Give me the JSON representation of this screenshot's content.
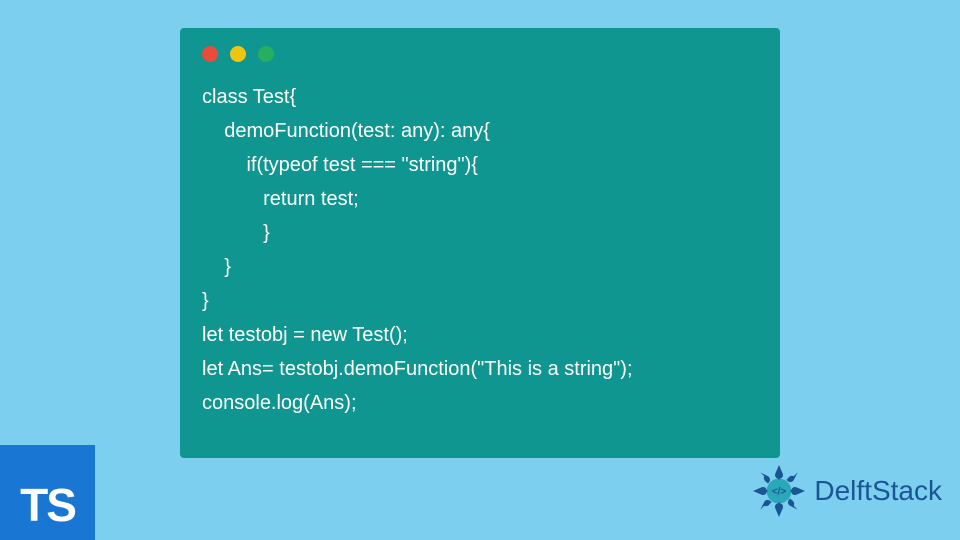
{
  "code": {
    "line1": "class Test{",
    "line2": "    demoFunction(test: any): any{",
    "line3": "        if(typeof test === \"string\"){",
    "line4": "           return test;",
    "line5": "           }",
    "line6": "    }",
    "line7": "}",
    "line8": "let testobj = new Test();",
    "line9": "let Ans= testobj.demoFunction(\"This is a string\");",
    "line10": "console.log(Ans);"
  },
  "badge": {
    "ts": "TS"
  },
  "logo": {
    "text": "DelftStack"
  }
}
